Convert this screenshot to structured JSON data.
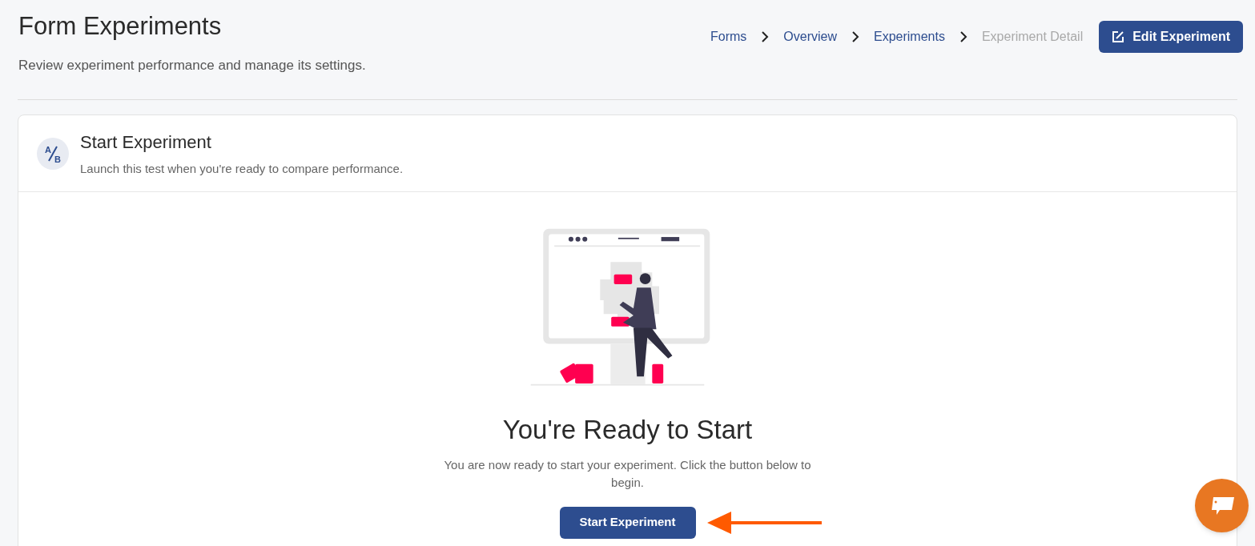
{
  "page": {
    "title": "Form Experiments",
    "subtitle": "Review experiment performance and manage its settings."
  },
  "breadcrumbs": [
    {
      "label": "Forms",
      "selected": false
    },
    {
      "label": "Overview",
      "selected": false
    },
    {
      "label": "Experiments",
      "selected": false
    },
    {
      "label": "Experiment Detail",
      "selected": true
    }
  ],
  "edit_button": {
    "label": "Edit Experiment"
  },
  "card": {
    "icon_letters": [
      "A",
      "B"
    ],
    "title": "Start Experiment",
    "subtitle": "Launch this test when you're ready to compare performance.",
    "empty_state": {
      "heading": "You're Ready to Start",
      "text": "You are now ready to start your experiment. Click the button below to begin.",
      "button": "Start Experiment"
    }
  }
}
